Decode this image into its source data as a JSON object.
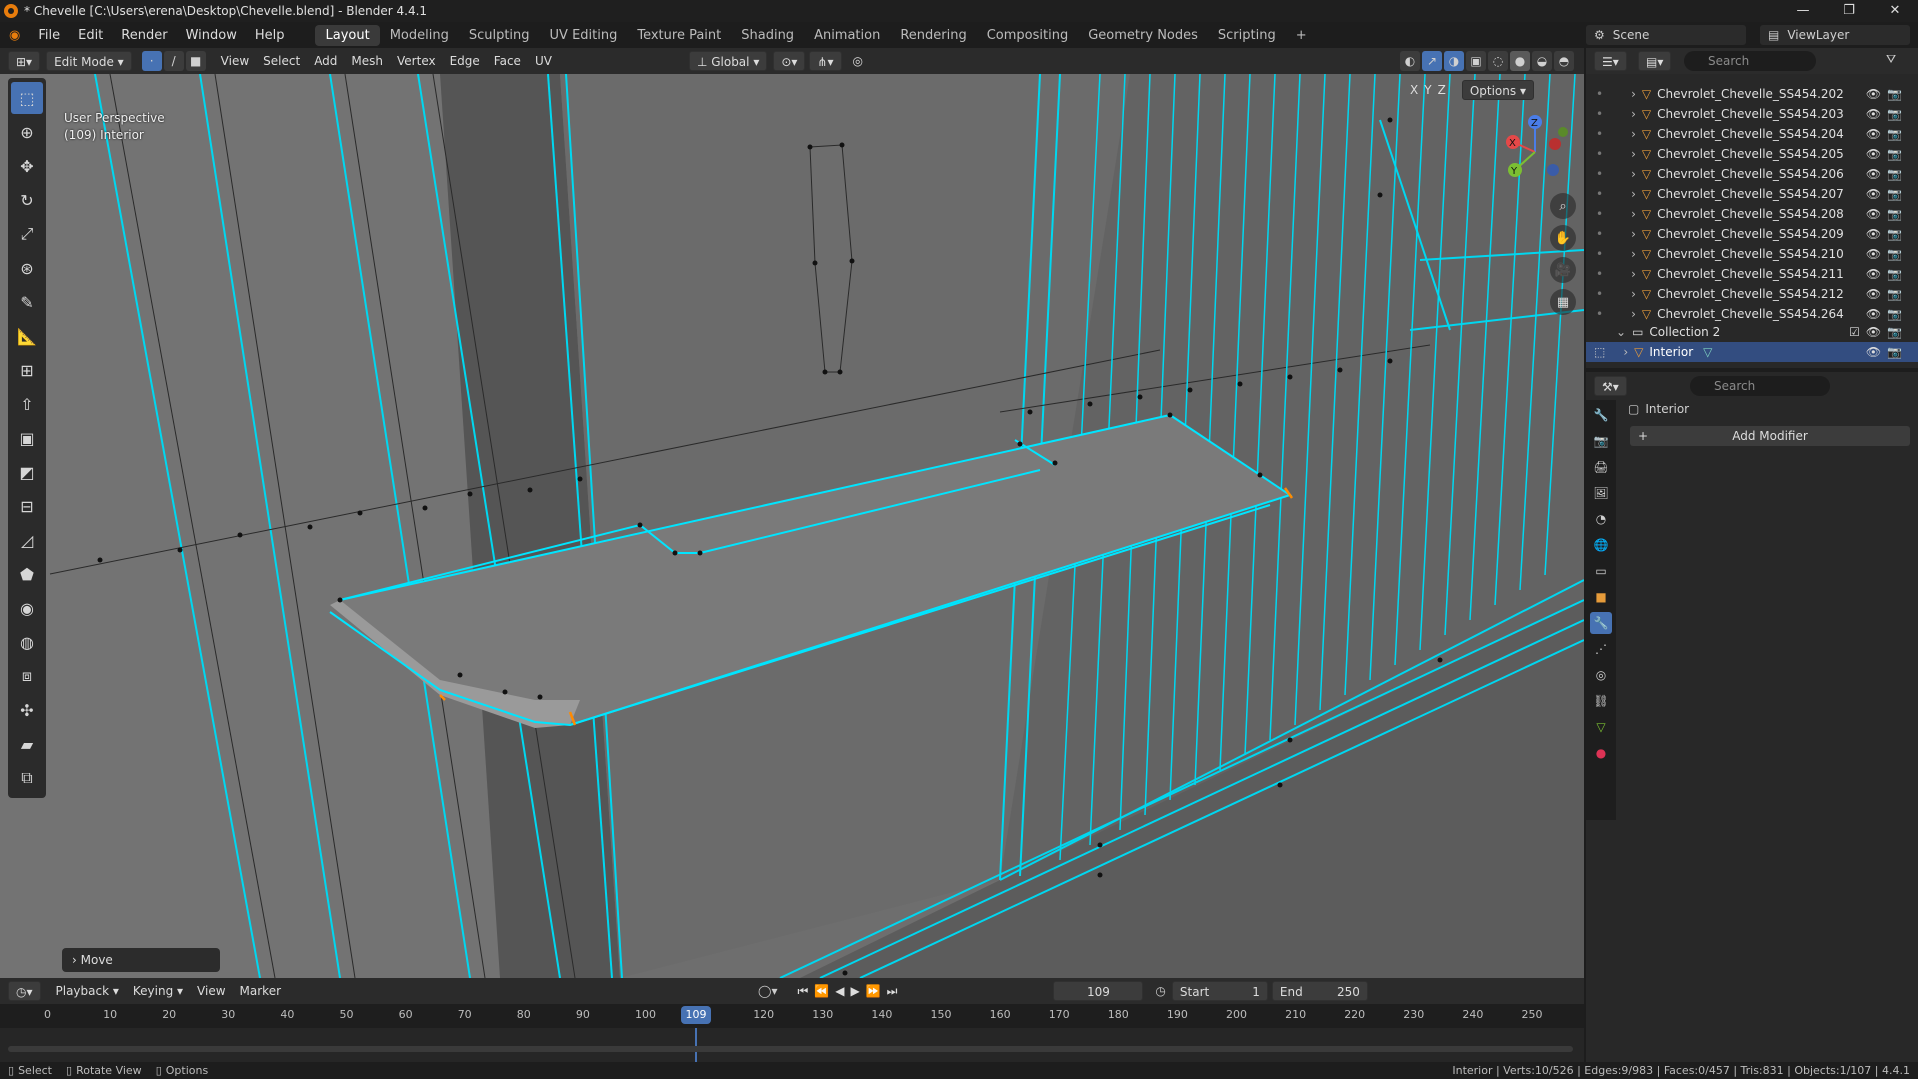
{
  "window": {
    "title": "* Chevelle [C:\\Users\\erena\\Desktop\\Chevelle.blend] - Blender 4.4.1",
    "min": "—",
    "max": "❐",
    "close": "✕"
  },
  "menu": [
    "File",
    "Edit",
    "Render",
    "Window",
    "Help"
  ],
  "workspaces": [
    "Layout",
    "Modeling",
    "Sculpting",
    "UV Editing",
    "Texture Paint",
    "Shading",
    "Animation",
    "Rendering",
    "Compositing",
    "Geometry Nodes",
    "Scripting"
  ],
  "active_workspace": "Layout",
  "scene": {
    "label": "Scene",
    "viewlayer": "ViewLayer"
  },
  "viewport_header": {
    "mode": "Edit Mode",
    "menus": [
      "View",
      "Select",
      "Add",
      "Mesh",
      "Vertex",
      "Edge",
      "Face",
      "UV"
    ],
    "orientation": "Global",
    "options": "Options",
    "axes": [
      "X",
      "Y",
      "Z"
    ]
  },
  "viewport": {
    "perspective": "User Perspective",
    "object": "(109) Interior",
    "last_op": "Move"
  },
  "gizmo": {
    "x": "X",
    "y": "Y",
    "z": "Z"
  },
  "outliner": {
    "search_placeholder": "Search",
    "items": [
      "Chevrolet_Chevelle_SS454.202",
      "Chevrolet_Chevelle_SS454.203",
      "Chevrolet_Chevelle_SS454.204",
      "Chevrolet_Chevelle_SS454.205",
      "Chevrolet_Chevelle_SS454.206",
      "Chevrolet_Chevelle_SS454.207",
      "Chevrolet_Chevelle_SS454.208",
      "Chevrolet_Chevelle_SS454.209",
      "Chevrolet_Chevelle_SS454.210",
      "Chevrolet_Chevelle_SS454.211",
      "Chevrolet_Chevelle_SS454.212",
      "Chevrolet_Chevelle_SS454.264"
    ],
    "collection": "Collection 2",
    "selected": "Interior"
  },
  "properties": {
    "search_placeholder": "Search",
    "object_name": "Interior",
    "add_modifier": "Add Modifier"
  },
  "timeline": {
    "menus": [
      "Playback",
      "Keying",
      "View",
      "Marker"
    ],
    "current_frame": "109",
    "start_label": "Start",
    "start": "1",
    "end_label": "End",
    "end": "250",
    "ticks": [
      "0",
      "10",
      "20",
      "30",
      "40",
      "50",
      "60",
      "70",
      "80",
      "90",
      "100",
      "120",
      "130",
      "140",
      "150",
      "160",
      "170",
      "180",
      "190",
      "200",
      "210",
      "220",
      "230",
      "240",
      "250"
    ]
  },
  "status": {
    "left": [
      "Select",
      "Rotate View",
      "Options"
    ],
    "right": "Interior | Verts:10/526 | Edges:9/983 | Faces:0/457 | Tris:831 | Objects:1/107 | 4.4.1"
  },
  "colors": {
    "accent": "#4772b3",
    "wire": "#00e5ff",
    "selected_edge": "#ff8a00"
  }
}
